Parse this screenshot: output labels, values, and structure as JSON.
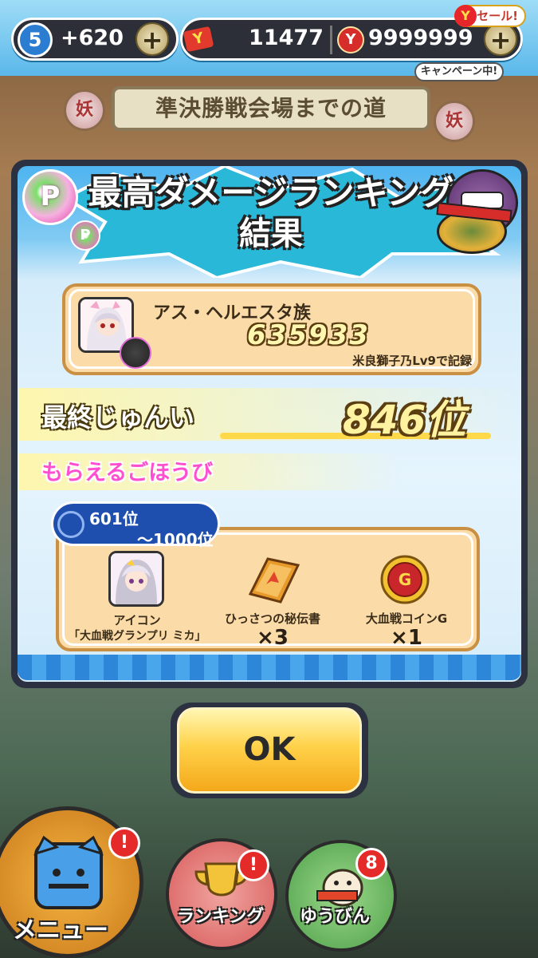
{
  "status_bar": {
    "level": "5",
    "stamina": "+620",
    "ticket_count": "11477",
    "money": "9999999",
    "plus_label": "+",
    "sale_label": "セール!",
    "campaign_label": "キャンペーン中!",
    "ticket_glyph": "Y",
    "money_glyph": "Y"
  },
  "stage_banner": {
    "title": "準決勝戦会場までの道",
    "mark": "妖"
  },
  "dialog": {
    "title_line1": "最高ダメージランキング",
    "title_line2": "結果",
    "p_badge": "P",
    "record": {
      "team_name": "アス・ヘルエスタ族",
      "score": "635933",
      "recorded_by": "米良獅子乃Lv9で記録"
    },
    "final_rank_label": "最終じゅんい",
    "final_rank_value": "846位",
    "reward_label": "もらえるごほうび",
    "rank_range_from": "601位",
    "rank_range_to": "～1000位",
    "rewards": [
      {
        "name": "アイコン\n「大血戦グランプリ ミカ」",
        "qty": "",
        "icon": "portrait-icon"
      },
      {
        "name": "ひっさつの秘伝書",
        "qty": "×3",
        "icon": "book-icon"
      },
      {
        "name": "大血戦コインG",
        "qty": "×1",
        "icon": "coin-icon"
      }
    ],
    "reward_icon_line1": "アイコン",
    "reward_icon_line2": "「大血戦グランプリ ミカ」",
    "ok_label": "OK"
  },
  "bottom_nav": {
    "menu_label": "メニュー",
    "ranking_label": "ランキング",
    "mail_label": "ゆうびん",
    "menu_alert": "!",
    "ranking_alert": "!",
    "mail_count": "8"
  },
  "colors": {
    "accent_blue": "#4fb4f0",
    "card_bg": "#fbdca8",
    "rank_gold": "#ffd94a",
    "reward_pink": "#ff4fd0",
    "alert_red": "#e52a2a"
  }
}
